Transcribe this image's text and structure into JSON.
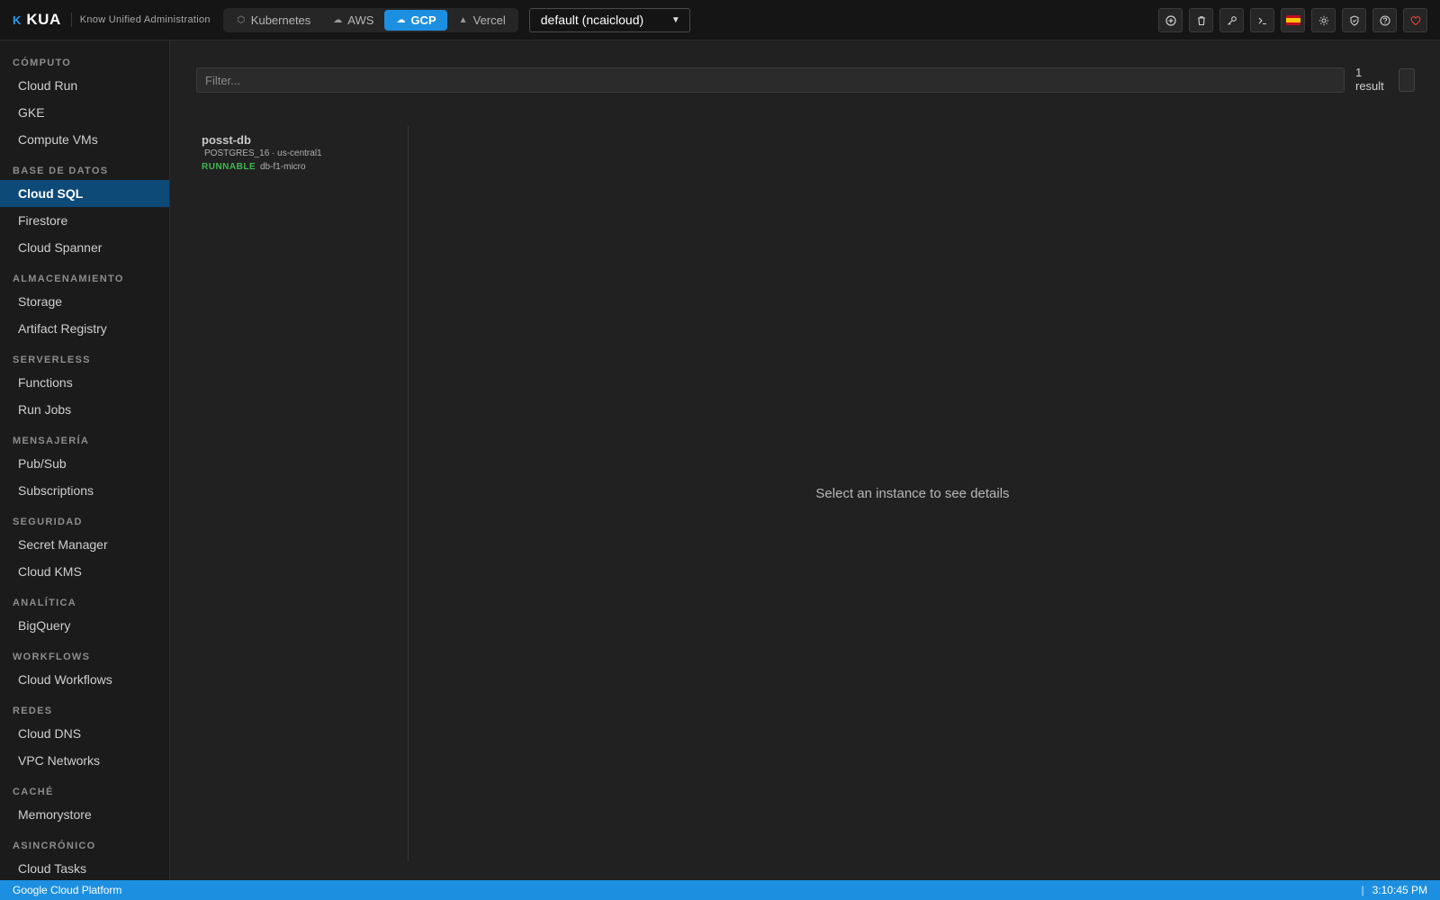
{
  "brand": {
    "mark": "K",
    "name": "KUA",
    "subtitle": "Know Unified Administration"
  },
  "providers": [
    {
      "label": "Kubernetes",
      "icon": "cube-icon",
      "active": false
    },
    {
      "label": "AWS",
      "icon": "cloud-icon",
      "active": false
    },
    {
      "label": "GCP",
      "icon": "cloud-upload-icon",
      "active": true
    },
    {
      "label": "Vercel",
      "icon": "triangle-icon",
      "active": false
    }
  ],
  "context": {
    "selected": "default (ncaicloud)"
  },
  "toolbar": [
    {
      "icon": "add-circle-icon"
    },
    {
      "icon": "trash-icon"
    },
    {
      "icon": "key-icon"
    },
    {
      "icon": "terminal-icon"
    },
    {
      "icon": "spain-flag-icon"
    },
    {
      "icon": "sun-icon"
    },
    {
      "icon": "shield-icon"
    },
    {
      "icon": "help-icon"
    },
    {
      "icon": "heart-icon"
    }
  ],
  "sidebar": {
    "sections": [
      {
        "title": "CÓMPUTO",
        "items": [
          "Cloud Run",
          "GKE",
          "Compute VMs"
        ]
      },
      {
        "title": "BASE DE DATOS",
        "items": [
          "Cloud SQL",
          "Firestore",
          "Cloud Spanner"
        ]
      },
      {
        "title": "ALMACENAMIENTO",
        "items": [
          "Storage",
          "Artifact Registry"
        ]
      },
      {
        "title": "SERVERLESS",
        "items": [
          "Functions",
          "Run Jobs"
        ]
      },
      {
        "title": "MENSAJERÍA",
        "items": [
          "Pub/Sub",
          "Subscriptions"
        ]
      },
      {
        "title": "SEGURIDAD",
        "items": [
          "Secret Manager",
          "Cloud KMS"
        ]
      },
      {
        "title": "ANALÍTICA",
        "items": [
          "BigQuery"
        ]
      },
      {
        "title": "WORKFLOWS",
        "items": [
          "Cloud Workflows"
        ]
      },
      {
        "title": "REDES",
        "items": [
          "Cloud DNS",
          "VPC Networks"
        ]
      },
      {
        "title": "CACHÉ",
        "items": [
          "Memorystore"
        ]
      },
      {
        "title": "ASINCRÓNICO",
        "items": [
          "Cloud Tasks"
        ]
      }
    ],
    "active_item": "Cloud SQL"
  },
  "main": {
    "filter_placeholder": "Filter...",
    "filter_value": "",
    "result_count": "1",
    "result_label": "result",
    "instances": [
      {
        "name": "posst-db",
        "meta": "POSTGRES_16 · us-central1",
        "status": "RUNNABLE",
        "tier": "db-f1-micro",
        "status_color": "#3fb950"
      }
    ],
    "empty_detail": "Select an instance to see details"
  },
  "statusbar": {
    "left": "Google Cloud Platform",
    "separator": "|",
    "time": "3:10:45 PM"
  },
  "colors": {
    "accent": "#1d8fe0",
    "active_nav": "#0d4a78",
    "runnable": "#3fb950"
  }
}
